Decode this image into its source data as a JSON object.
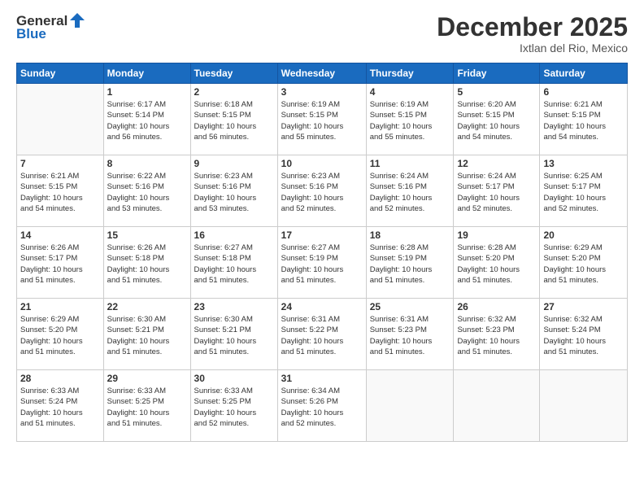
{
  "logo": {
    "general": "General",
    "blue": "Blue"
  },
  "header": {
    "month": "December 2025",
    "location": "Ixtlan del Rio, Mexico"
  },
  "weekdays": [
    "Sunday",
    "Monday",
    "Tuesday",
    "Wednesday",
    "Thursday",
    "Friday",
    "Saturday"
  ],
  "weeks": [
    [
      {
        "day": "",
        "info": ""
      },
      {
        "day": "1",
        "info": "Sunrise: 6:17 AM\nSunset: 5:14 PM\nDaylight: 10 hours\nand 56 minutes."
      },
      {
        "day": "2",
        "info": "Sunrise: 6:18 AM\nSunset: 5:15 PM\nDaylight: 10 hours\nand 56 minutes."
      },
      {
        "day": "3",
        "info": "Sunrise: 6:19 AM\nSunset: 5:15 PM\nDaylight: 10 hours\nand 55 minutes."
      },
      {
        "day": "4",
        "info": "Sunrise: 6:19 AM\nSunset: 5:15 PM\nDaylight: 10 hours\nand 55 minutes."
      },
      {
        "day": "5",
        "info": "Sunrise: 6:20 AM\nSunset: 5:15 PM\nDaylight: 10 hours\nand 54 minutes."
      },
      {
        "day": "6",
        "info": "Sunrise: 6:21 AM\nSunset: 5:15 PM\nDaylight: 10 hours\nand 54 minutes."
      }
    ],
    [
      {
        "day": "7",
        "info": "Sunrise: 6:21 AM\nSunset: 5:15 PM\nDaylight: 10 hours\nand 54 minutes."
      },
      {
        "day": "8",
        "info": "Sunrise: 6:22 AM\nSunset: 5:16 PM\nDaylight: 10 hours\nand 53 minutes."
      },
      {
        "day": "9",
        "info": "Sunrise: 6:23 AM\nSunset: 5:16 PM\nDaylight: 10 hours\nand 53 minutes."
      },
      {
        "day": "10",
        "info": "Sunrise: 6:23 AM\nSunset: 5:16 PM\nDaylight: 10 hours\nand 52 minutes."
      },
      {
        "day": "11",
        "info": "Sunrise: 6:24 AM\nSunset: 5:16 PM\nDaylight: 10 hours\nand 52 minutes."
      },
      {
        "day": "12",
        "info": "Sunrise: 6:24 AM\nSunset: 5:17 PM\nDaylight: 10 hours\nand 52 minutes."
      },
      {
        "day": "13",
        "info": "Sunrise: 6:25 AM\nSunset: 5:17 PM\nDaylight: 10 hours\nand 52 minutes."
      }
    ],
    [
      {
        "day": "14",
        "info": "Sunrise: 6:26 AM\nSunset: 5:17 PM\nDaylight: 10 hours\nand 51 minutes."
      },
      {
        "day": "15",
        "info": "Sunrise: 6:26 AM\nSunset: 5:18 PM\nDaylight: 10 hours\nand 51 minutes."
      },
      {
        "day": "16",
        "info": "Sunrise: 6:27 AM\nSunset: 5:18 PM\nDaylight: 10 hours\nand 51 minutes."
      },
      {
        "day": "17",
        "info": "Sunrise: 6:27 AM\nSunset: 5:19 PM\nDaylight: 10 hours\nand 51 minutes."
      },
      {
        "day": "18",
        "info": "Sunrise: 6:28 AM\nSunset: 5:19 PM\nDaylight: 10 hours\nand 51 minutes."
      },
      {
        "day": "19",
        "info": "Sunrise: 6:28 AM\nSunset: 5:20 PM\nDaylight: 10 hours\nand 51 minutes."
      },
      {
        "day": "20",
        "info": "Sunrise: 6:29 AM\nSunset: 5:20 PM\nDaylight: 10 hours\nand 51 minutes."
      }
    ],
    [
      {
        "day": "21",
        "info": "Sunrise: 6:29 AM\nSunset: 5:20 PM\nDaylight: 10 hours\nand 51 minutes."
      },
      {
        "day": "22",
        "info": "Sunrise: 6:30 AM\nSunset: 5:21 PM\nDaylight: 10 hours\nand 51 minutes."
      },
      {
        "day": "23",
        "info": "Sunrise: 6:30 AM\nSunset: 5:21 PM\nDaylight: 10 hours\nand 51 minutes."
      },
      {
        "day": "24",
        "info": "Sunrise: 6:31 AM\nSunset: 5:22 PM\nDaylight: 10 hours\nand 51 minutes."
      },
      {
        "day": "25",
        "info": "Sunrise: 6:31 AM\nSunset: 5:23 PM\nDaylight: 10 hours\nand 51 minutes."
      },
      {
        "day": "26",
        "info": "Sunrise: 6:32 AM\nSunset: 5:23 PM\nDaylight: 10 hours\nand 51 minutes."
      },
      {
        "day": "27",
        "info": "Sunrise: 6:32 AM\nSunset: 5:24 PM\nDaylight: 10 hours\nand 51 minutes."
      }
    ],
    [
      {
        "day": "28",
        "info": "Sunrise: 6:33 AM\nSunset: 5:24 PM\nDaylight: 10 hours\nand 51 minutes."
      },
      {
        "day": "29",
        "info": "Sunrise: 6:33 AM\nSunset: 5:25 PM\nDaylight: 10 hours\nand 51 minutes."
      },
      {
        "day": "30",
        "info": "Sunrise: 6:33 AM\nSunset: 5:25 PM\nDaylight: 10 hours\nand 52 minutes."
      },
      {
        "day": "31",
        "info": "Sunrise: 6:34 AM\nSunset: 5:26 PM\nDaylight: 10 hours\nand 52 minutes."
      },
      {
        "day": "",
        "info": ""
      },
      {
        "day": "",
        "info": ""
      },
      {
        "day": "",
        "info": ""
      }
    ]
  ]
}
